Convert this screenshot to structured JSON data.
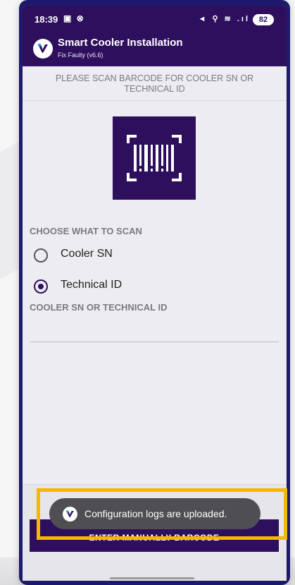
{
  "status_bar": {
    "time": "18:39",
    "notification_icons": "▣ ⊗",
    "system_icons": "◄ ⚲ ≋ .ıl",
    "battery": "82"
  },
  "app": {
    "title": "Smart Cooler Installation",
    "subtitle": "Fix Faulty (v6.6)"
  },
  "scan": {
    "prompt": "PLEASE SCAN BARCODE FOR COOLER SN OR TECHNICAL ID"
  },
  "choose": {
    "heading": "CHOOSE WHAT TO SCAN",
    "options": [
      {
        "label": "Cooler SN",
        "selected": false
      },
      {
        "label": "Technical ID",
        "selected": true
      }
    ]
  },
  "field": {
    "label": "COOLER SN OR TECHNICAL ID",
    "value": "",
    "placeholder": ""
  },
  "manual_button": {
    "label": "ENTER MANUALLY BARCODE"
  },
  "toast": {
    "message": "Configuration logs are uploaded."
  },
  "colors": {
    "brand": "#2e0f5e",
    "frame": "#1c1a6b",
    "highlight": "#f5b800",
    "toast_bg": "#4f4f53"
  },
  "icons": {
    "app_logo": "brand-v-logo-icon",
    "scan": "barcode-scan-icon"
  }
}
